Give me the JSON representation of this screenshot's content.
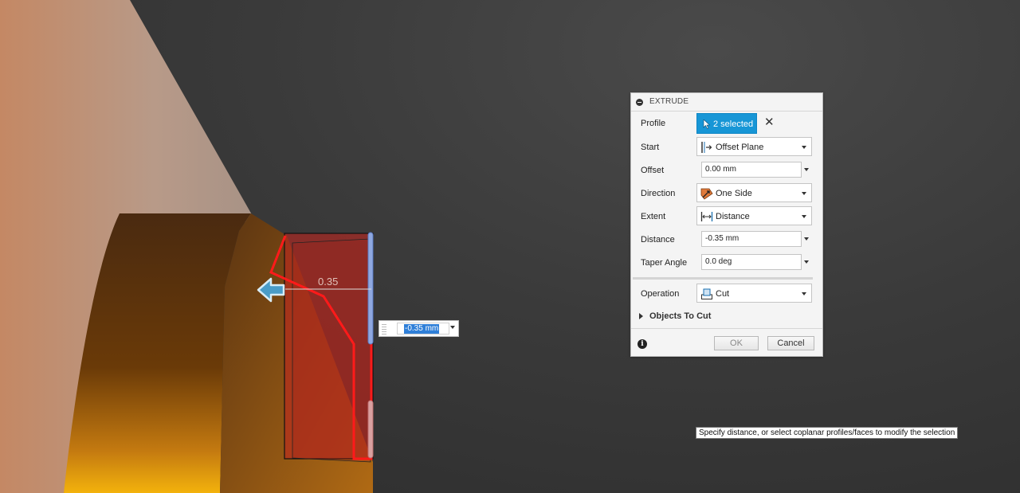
{
  "viewport": {
    "dimension_label": "0.35",
    "inline_input": {
      "value": "-0.35 mm"
    }
  },
  "dialog": {
    "title": "EXTRUDE",
    "rows": {
      "profile": {
        "label": "Profile",
        "value": "2 selected",
        "clear_glyph": "✕"
      },
      "start": {
        "label": "Start",
        "value": "Offset Plane"
      },
      "offset": {
        "label": "Offset",
        "value": "0.00 mm"
      },
      "direction": {
        "label": "Direction",
        "value": "One Side"
      },
      "extent": {
        "label": "Extent",
        "value": "Distance"
      },
      "distance": {
        "label": "Distance",
        "value": "-0.35 mm"
      },
      "taper_angle": {
        "label": "Taper Angle",
        "value": "0.0 deg"
      },
      "operation": {
        "label": "Operation",
        "value": "Cut"
      }
    },
    "objects_to_cut": "Objects To Cut",
    "info_glyph": "i",
    "ok_label": "OK",
    "cancel_label": "Cancel"
  },
  "tooltip": "Specify distance, or select coplanar profiles/faces to modify the selection",
  "colors": {
    "accent": "#1796d6",
    "cut_region": "#c0271f",
    "outline_red": "#ff1a1a",
    "arrow_manipulator": "#4a9cc7"
  },
  "icons": [
    "collapse-icon",
    "cursor-icon",
    "close-icon",
    "offset-plane-icon",
    "direction-icon",
    "distance-icon",
    "cut-icon",
    "info-icon",
    "arrow-manipulator-icon"
  ]
}
